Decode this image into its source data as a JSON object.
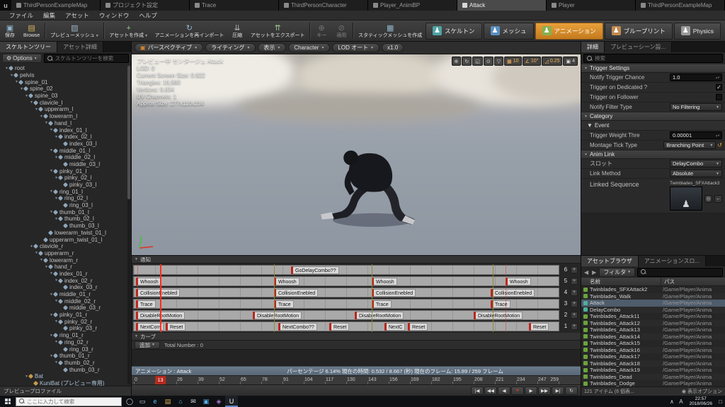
{
  "window_tabs": [
    {
      "label": "ThirdPersonExampleMap",
      "active": false
    },
    {
      "label": "プロジェクト設定",
      "active": false
    },
    {
      "label": "Trace",
      "active": false
    },
    {
      "label": "ThirdPersonCharacter",
      "active": false
    },
    {
      "label": "Player_AnimBP",
      "active": false
    },
    {
      "label": "Attack",
      "active": true
    },
    {
      "label": "Player",
      "active": false
    },
    {
      "label": "ThirdPersonExampleMap",
      "active": false
    }
  ],
  "menu": {
    "items": [
      "ファイル",
      "編集",
      "アセット",
      "ウィンドウ",
      "ヘルプ"
    ]
  },
  "toolbar": {
    "buttons": [
      {
        "label": "保存",
        "icon": "save-icon",
        "glyph": "▣",
        "color": "#8fb3c8"
      },
      {
        "label": "Browse",
        "icon": "browse-icon",
        "glyph": "▤",
        "color": "#d2b25a"
      },
      {
        "type": "sep"
      },
      {
        "label": "プレビューメッシュ",
        "icon": "preview-mesh-icon",
        "glyph": "▧",
        "color": "#9ab0c0",
        "dropdown": true
      },
      {
        "type": "sep"
      },
      {
        "label": "アセットを作成",
        "icon": "create-asset-icon",
        "glyph": "+",
        "color": "#8fc48f",
        "dropdown": true
      },
      {
        "label": "アニメーションを再インポート",
        "icon": "reimport-icon",
        "glyph": "↻",
        "color": "#8fb3c8"
      },
      {
        "label": "圧縮",
        "icon": "compress-icon",
        "glyph": "⇊",
        "color": "#b0b0b0"
      },
      {
        "label": "アセットをエクスポート",
        "icon": "export-icon",
        "glyph": "⇈",
        "color": "#9ec08f"
      },
      {
        "type": "sep"
      },
      {
        "label": "キー",
        "icon": "key-icon",
        "glyph": "⊕",
        "color": "#b0b0b0",
        "disabled": true
      },
      {
        "label": "適用",
        "icon": "apply-icon",
        "glyph": "⊘",
        "color": "#b0b0b0",
        "disabled": true
      },
      {
        "type": "sep"
      },
      {
        "label": "スタティックメッシュを作成",
        "icon": "make-static-mesh-icon",
        "glyph": "▦",
        "color": "#8fb3c8"
      }
    ],
    "modes": [
      {
        "label": "スケルトン",
        "active": false,
        "color": "#4fa3a5"
      },
      {
        "label": "メッシュ",
        "active": false,
        "color": "#5a8fc0"
      },
      {
        "label": "アニメーション",
        "active": true,
        "color": "#86b050"
      },
      {
        "label": "ブループリント",
        "active": false,
        "color": "#c08a50"
      },
      {
        "label": "Physics",
        "active": false,
        "color": "#9a9a9a"
      }
    ]
  },
  "skeleton": {
    "tabs": [
      {
        "label": "スケルトンツリー",
        "active": true
      },
      {
        "label": "アセット詳細",
        "active": false
      }
    ],
    "options_label": "Options",
    "search_placeholder": "スケルトンツリーを検索",
    "footer": "プレビュープロファイル",
    "bones": [
      {
        "l": "root",
        "i": 0
      },
      {
        "l": "pelvis",
        "i": 1
      },
      {
        "l": "spine_01",
        "i": 2
      },
      {
        "l": "spine_02",
        "i": 3
      },
      {
        "l": "spine_03",
        "i": 4
      },
      {
        "l": "clavicle_l",
        "i": 5
      },
      {
        "l": "upperarm_l",
        "i": 6
      },
      {
        "l": "lowerarm_l",
        "i": 7
      },
      {
        "l": "hand_l",
        "i": 8
      },
      {
        "l": "index_01_l",
        "i": 9
      },
      {
        "l": "index_02_l",
        "i": 10
      },
      {
        "l": "index_03_l",
        "i": 11
      },
      {
        "l": "middle_01_l",
        "i": 9
      },
      {
        "l": "middle_02_l",
        "i": 10
      },
      {
        "l": "middle_03_l",
        "i": 11
      },
      {
        "l": "pinky_01_l",
        "i": 9
      },
      {
        "l": "pinky_02_l",
        "i": 10
      },
      {
        "l": "pinky_03_l",
        "i": 11
      },
      {
        "l": "ring_01_l",
        "i": 9
      },
      {
        "l": "ring_02_l",
        "i": 10
      },
      {
        "l": "ring_03_l",
        "i": 11
      },
      {
        "l": "thumb_01_l",
        "i": 9
      },
      {
        "l": "thumb_02_l",
        "i": 10
      },
      {
        "l": "thumb_03_l",
        "i": 11
      },
      {
        "l": "lowerarm_twist_01_l",
        "i": 8
      },
      {
        "l": "upperarm_twist_01_l",
        "i": 7
      },
      {
        "l": "clavicle_r",
        "i": 5
      },
      {
        "l": "upperarm_r",
        "i": 6
      },
      {
        "l": "lowerarm_r",
        "i": 7
      },
      {
        "l": "hand_r",
        "i": 8
      },
      {
        "l": "index_01_r",
        "i": 9
      },
      {
        "l": "index_02_r",
        "i": 10
      },
      {
        "l": "index_03_r",
        "i": 11
      },
      {
        "l": "middle_01_r",
        "i": 9
      },
      {
        "l": "middle_02_r",
        "i": 10
      },
      {
        "l": "middle_03_r",
        "i": 11
      },
      {
        "l": "pinky_01_r",
        "i": 9
      },
      {
        "l": "pinky_02_r",
        "i": 10
      },
      {
        "l": "pinky_03_r",
        "i": 11
      },
      {
        "l": "ring_01_r",
        "i": 9
      },
      {
        "l": "ring_02_r",
        "i": 10
      },
      {
        "l": "ring_03_r",
        "i": 11
      },
      {
        "l": "thumb_01_r",
        "i": 9
      },
      {
        "l": "thumb_02_r",
        "i": 10
      },
      {
        "l": "thumb_03_r",
        "i": 11
      },
      {
        "l": "Bat",
        "i": 4,
        "special": true
      },
      {
        "l": "KuniBat (プレビュー専用)",
        "i": 5,
        "special": true
      }
    ]
  },
  "viewport": {
    "buttons": [
      {
        "label": "パースペクティブ",
        "accent": true,
        "caret": true
      },
      {
        "label": "ライティング",
        "caret": true
      },
      {
        "label": "表示",
        "caret": true
      },
      {
        "label": "Character",
        "caret": true
      },
      {
        "label": "LOD オート",
        "caret": true
      },
      {
        "label": "x1.0",
        "caret": false
      }
    ],
    "stats": [
      "プレビュー中 モンタージュ Attack",
      "LOD: 0",
      "Current Screen Size: 0.922",
      "Triangles: 16,980",
      "Vertices: 9,634",
      "UV Channels: 1",
      "Approx Size: 277x110x234"
    ],
    "gizmos": [
      {
        "name": "translate-tool-button",
        "glyph": "⊕"
      },
      {
        "name": "rotate-tool-button",
        "glyph": "↻"
      },
      {
        "name": "scale-tool-button",
        "glyph": "◱"
      },
      {
        "name": "coordinate-system-button",
        "glyph": "⊙"
      },
      {
        "name": "surface-snap-button",
        "glyph": "▽"
      },
      {
        "name": "grid-snap-button",
        "glyph": "▦",
        "label": "10",
        "active": true
      },
      {
        "name": "rotation-snap-button",
        "glyph": "∠",
        "label": "10°",
        "active": true
      },
      {
        "name": "scale-snap-button",
        "glyph": "◿",
        "label": "0.25",
        "active": true
      },
      {
        "name": "camera-speed-button",
        "glyph": "▣",
        "label": "4"
      }
    ]
  },
  "notify": {
    "header": "通知",
    "curves_header": "カーブ",
    "add_button": "追加",
    "total_label": "Total Number : 0",
    "montage_label": "アニメーション : Attack",
    "stats_label": "パーセンテージ 6.14%  現在の時間: 0.532 / 8.667 (秒)  現在のフレーム: 15.89 / 259 フレーム",
    "playhead_percent": 6.14,
    "playhead_tick": "13",
    "section_lines": [
      33,
      56,
      84.5
    ],
    "marker_lines": [
      0.8,
      33,
      56,
      84.5,
      87.5
    ],
    "tracks": [
      {
        "num": "6",
        "notifies": [
          {
            "label": "GoDelayCombo??",
            "pos": 37
          }
        ]
      },
      {
        "num": "5",
        "notifies": [
          {
            "label": "Whoosh",
            "pos": 0.5
          },
          {
            "label": "Whoosh",
            "pos": 33
          },
          {
            "label": "Whoosh",
            "pos": 56
          },
          {
            "label": "Whoosh",
            "pos": 87.5
          }
        ]
      },
      {
        "num": "4",
        "notifies": [
          {
            "label": "CollisionEnebled",
            "pos": 0.5
          },
          {
            "label": "CollisionEnebled",
            "pos": 33
          },
          {
            "label": "CollisionEnebled",
            "pos": 56
          },
          {
            "label": "CollisionEnebled",
            "pos": 84
          }
        ]
      },
      {
        "num": "3",
        "notifies": [
          {
            "label": "Trace",
            "pos": 0.5
          },
          {
            "label": "Trace",
            "pos": 33
          },
          {
            "label": "Trace",
            "pos": 56
          },
          {
            "label": "Trace",
            "pos": 84
          }
        ]
      },
      {
        "num": "2",
        "notifies": [
          {
            "label": "DisableRootMotion",
            "pos": 0.5
          },
          {
            "label": "DisableRootMotion",
            "pos": 28
          },
          {
            "label": "DisableRootMotion",
            "pos": 52
          },
          {
            "label": "DisableRootMotion",
            "pos": 80
          }
        ]
      },
      {
        "num": "1",
        "notifies": [
          {
            "label": "NextCom",
            "pos": 0.5
          },
          {
            "label": "Reset",
            "pos": 7.5
          },
          {
            "label": "NextCombo??",
            "pos": 34
          },
          {
            "label": "Reset",
            "pos": 46
          },
          {
            "label": "NextC",
            "pos": 59
          },
          {
            "label": "Reset",
            "pos": 64.5
          },
          {
            "label": "Reset",
            "pos": 93
          }
        ]
      }
    ],
    "ruler_ticks": [
      "0",
      "13",
      "26",
      "39",
      "52",
      "65",
      "78",
      "91",
      "104",
      "117",
      "130",
      "143",
      "156",
      "169",
      "182",
      "195",
      "208",
      "221",
      "234",
      "247",
      "259"
    ],
    "transport": [
      {
        "name": "go-to-front-button",
        "glyph": "|◀"
      },
      {
        "name": "step-backward-button",
        "glyph": "◀◀"
      },
      {
        "name": "play-reverse-button",
        "glyph": "◀"
      },
      {
        "name": "record-button",
        "glyph": "●",
        "record": true
      },
      {
        "name": "play-button",
        "glyph": "▶"
      },
      {
        "name": "step-forward-button",
        "glyph": "▶▶"
      },
      {
        "name": "go-to-end-button",
        "glyph": "▶|"
      },
      {
        "name": "loop-button",
        "glyph": "↻"
      }
    ]
  },
  "details": {
    "tabs": [
      {
        "label": "詳細",
        "active": true
      },
      {
        "label": "プレビューシーン設...",
        "active": false
      }
    ],
    "search_placeholder": "検索",
    "sections": [
      {
        "title": "Trigger Settings",
        "rows": [
          {
            "type": "number",
            "label": "Notify Trigger Chance",
            "value": "1.0"
          },
          {
            "type": "check",
            "label": "Trigger on Dedicated ?",
            "checked": true
          },
          {
            "type": "check",
            "label": "Trigger on Follower",
            "checked": false
          },
          {
            "type": "dropdown",
            "label": "Notify Filter Type",
            "value": "No Filtering"
          }
        ]
      },
      {
        "title": "Category",
        "rows": [
          {
            "type": "subheader",
            "label": "Event"
          },
          {
            "type": "number",
            "label": "Trigger Weight Thre",
            "value": "0.00001"
          },
          {
            "type": "dropdown",
            "label": "Montage Tick Type",
            "value": "Branching Point",
            "reset": true
          }
        ]
      },
      {
        "title": "Anim Link",
        "rows": [
          {
            "type": "dropdown",
            "label": "スロット",
            "value": "DelayCombo"
          },
          {
            "type": "dropdown",
            "label": "Link Method",
            "value": "Absolute"
          },
          {
            "type": "thumb",
            "label": "Linked Sequence",
            "value": "Twinblades_SFXAttack3"
          }
        ]
      }
    ]
  },
  "assets": {
    "tabs": [
      {
        "label": "アセットブラウザ",
        "active": true
      },
      {
        "label": "アニメーションスロ...",
        "active": false
      }
    ],
    "filter_label": "フィルタ",
    "search_placeholder": "",
    "columns": [
      "名前",
      "パス"
    ],
    "rows": [
      {
        "name": "Twinblades_SFXAttack2",
        "path": "/Game/Player/Anima",
        "c": "#6aa33c"
      },
      {
        "name": "Twinblades_Walk",
        "path": "/Game/Player/Anima",
        "c": "#6aa33c"
      },
      {
        "name": "Attack",
        "path": "/Game/Player/Anima",
        "c": "#4fae9e",
        "selected": true
      },
      {
        "name": "DelayCombo",
        "path": "/Game/Player/Anima",
        "c": "#4fae9e"
      },
      {
        "name": "Twinblades_Attack11",
        "path": "/Game/Player/Anima",
        "c": "#6aa33c"
      },
      {
        "name": "Twinblades_Attack12",
        "path": "/Game/Player/Anima",
        "c": "#6aa33c"
      },
      {
        "name": "Twinblades_Attack13",
        "path": "/Game/Player/Anima",
        "c": "#6aa33c"
      },
      {
        "name": "Twinblades_Attack14",
        "path": "/Game/Player/Anima",
        "c": "#6aa33c"
      },
      {
        "name": "Twinblades_Attack15",
        "path": "/Game/Player/Anima",
        "c": "#6aa33c"
      },
      {
        "name": "Twinblades_Attack16",
        "path": "/Game/Player/Anima",
        "c": "#6aa33c"
      },
      {
        "name": "Twinblades_Attack17",
        "path": "/Game/Player/Anima",
        "c": "#6aa33c"
      },
      {
        "name": "Twinblades_Attack18",
        "path": "/Game/Player/Anima",
        "c": "#6aa33c"
      },
      {
        "name": "Twinblades_Attack19",
        "path": "/Game/Player/Anima",
        "c": "#6aa33c"
      },
      {
        "name": "Twinblades_Dead",
        "path": "/Game/Player/Anima",
        "c": "#6aa33c"
      },
      {
        "name": "Twinblades_Dodge",
        "path": "/Game/Player/Anima",
        "c": "#6aa33c"
      }
    ],
    "footer": "121 アイテム (6 個表...",
    "view_options": "表示オプション"
  },
  "taskbar": {
    "search_placeholder": "ここに入力して検索",
    "icons": [
      {
        "name": "cortana-icon",
        "glyph": "◯",
        "color": "#cfd8e3"
      },
      {
        "name": "task-view-icon",
        "glyph": "▭",
        "color": "#cfd8e3"
      },
      {
        "name": "edge-icon",
        "glyph": "e",
        "color": "#4fc3f7"
      },
      {
        "name": "explorer-icon",
        "glyph": "▤",
        "color": "#d8b054"
      },
      {
        "name": "store-icon",
        "glyph": "⌂",
        "color": "#58b0e8"
      },
      {
        "name": "mail-icon",
        "glyph": "✉",
        "color": "#cfd8e3"
      },
      {
        "name": "photos-icon",
        "glyph": "▣",
        "color": "#58b0e8"
      },
      {
        "name": "visual-studio-icon",
        "glyph": "◈",
        "color": "#b07ad0"
      },
      {
        "name": "ue4-editor-icon",
        "glyph": "U",
        "color": "#ffffff",
        "active": true
      }
    ],
    "tray_up": "∧",
    "ime": "A",
    "time": "22:57",
    "date": "2018/06/26",
    "notification_glyph": "□"
  }
}
